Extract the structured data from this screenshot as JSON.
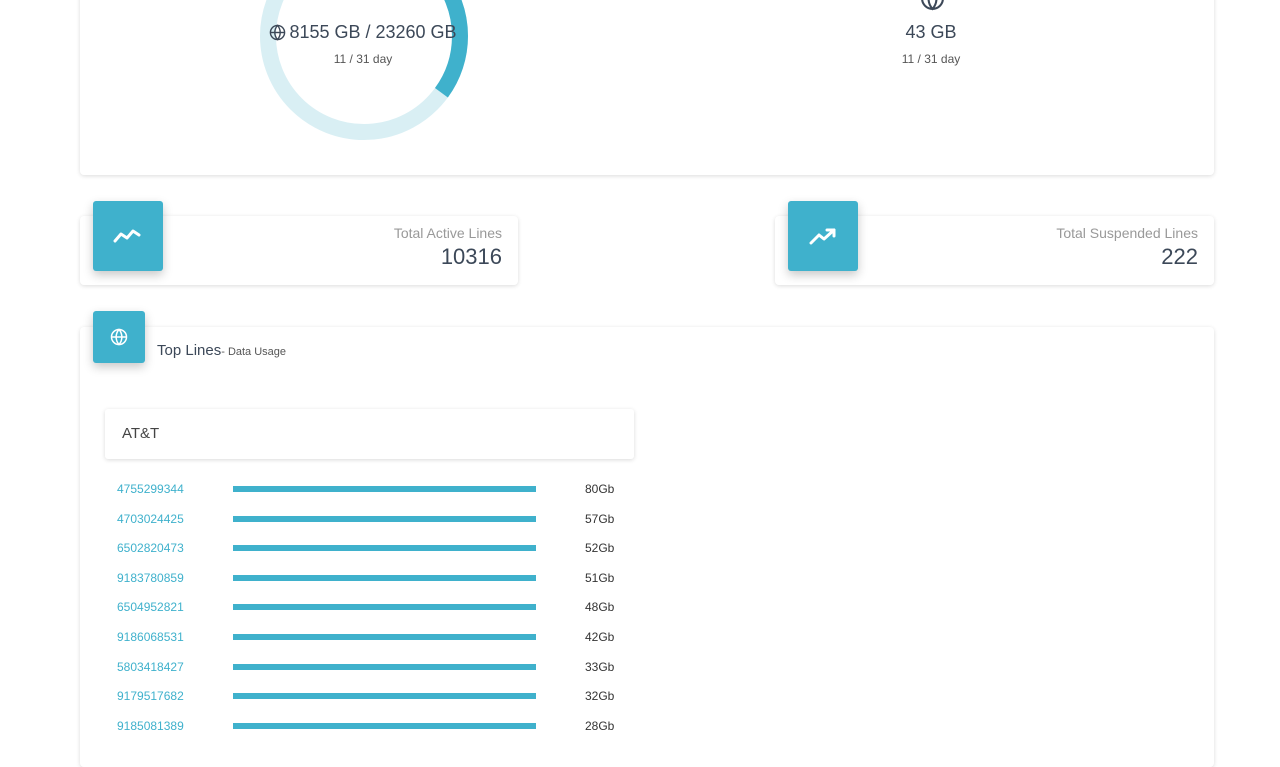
{
  "usage": {
    "total_value": "8155 GB / 23260 GB",
    "total_day": "11 / 31 day",
    "used_fraction": 0.3506,
    "secondary_value": "43 GB",
    "secondary_day": "11 / 31 day",
    "icon": "globe-icon"
  },
  "stats": {
    "active": {
      "label": "Total Active Lines",
      "value": "10316",
      "icon": "trend-line-icon"
    },
    "suspended": {
      "label": "Total Suspended Lines",
      "value": "222",
      "icon": "trending-up-icon"
    }
  },
  "top_lines": {
    "title": "Top Lines",
    "subtitle": "- Data Usage",
    "icon": "globe-icon",
    "carrier": "AT&T",
    "rows": [
      {
        "number": "4755299344",
        "usage": "80Gb"
      },
      {
        "number": "4703024425",
        "usage": "57Gb"
      },
      {
        "number": "6502820473",
        "usage": "52Gb"
      },
      {
        "number": "9183780859",
        "usage": "51Gb"
      },
      {
        "number": "6504952821",
        "usage": "48Gb"
      },
      {
        "number": "9186068531",
        "usage": "42Gb"
      },
      {
        "number": "5803418427",
        "usage": "33Gb"
      },
      {
        "number": "9179517682",
        "usage": "32Gb"
      },
      {
        "number": "9185081389",
        "usage": "28Gb"
      }
    ]
  },
  "colors": {
    "accent": "#3fb1cc",
    "accent_light": "#d9eff4",
    "text_dark": "#3c4858"
  }
}
